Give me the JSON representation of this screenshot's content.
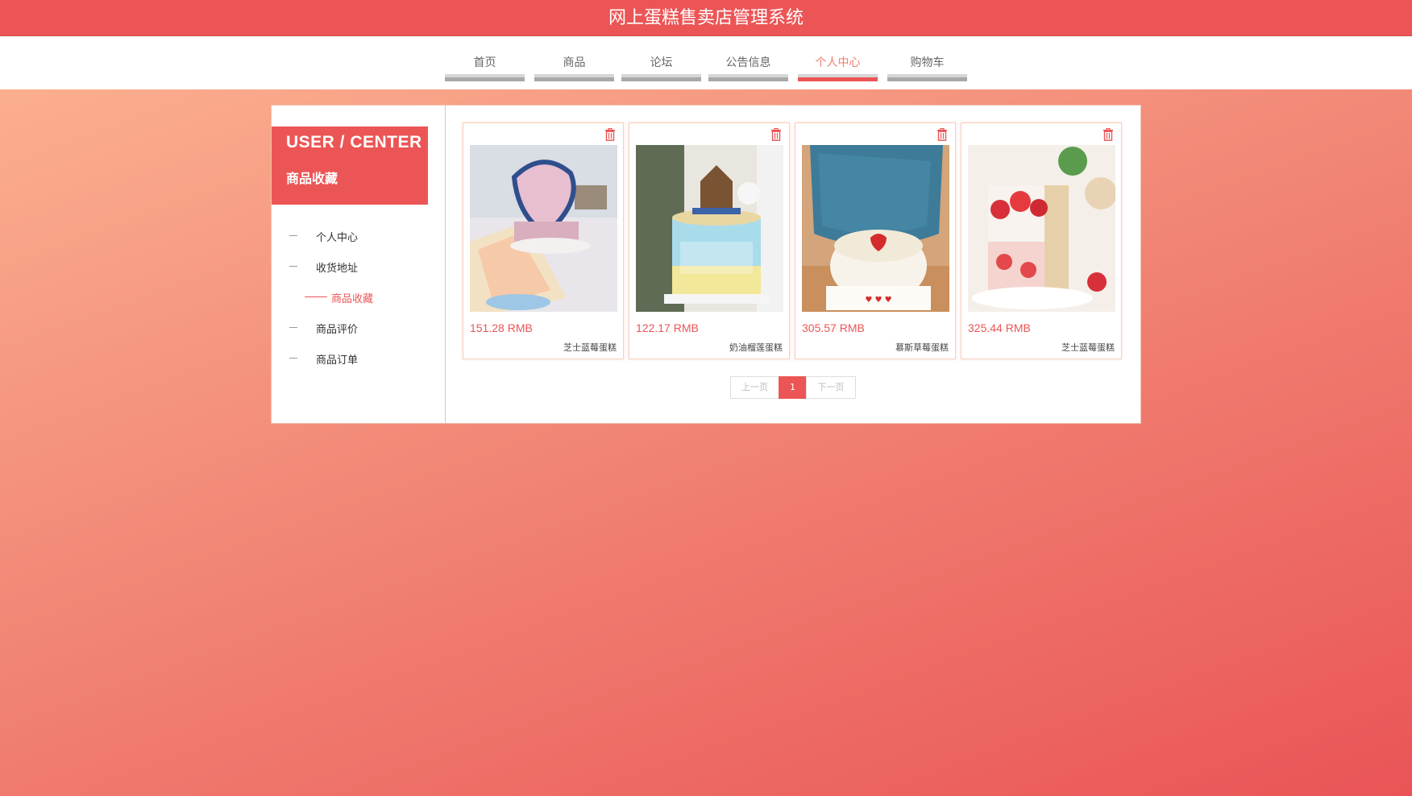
{
  "header": {
    "title": "网上蛋糕售卖店管理系统"
  },
  "nav": {
    "items": [
      {
        "label": "首页"
      },
      {
        "label": "商品"
      },
      {
        "label": "论坛"
      },
      {
        "label": "公告信息"
      },
      {
        "label": "个人中心"
      },
      {
        "label": "购物车"
      }
    ],
    "active": "个人中心"
  },
  "sidebar": {
    "title": "USER / CENTER",
    "subtitle": "商品收藏",
    "items": [
      {
        "label": "个人中心"
      },
      {
        "label": "收货地址"
      },
      {
        "label": "商品收藏"
      },
      {
        "label": "商品评价"
      },
      {
        "label": "商品订单"
      }
    ],
    "active": "商品收藏"
  },
  "favorites": [
    {
      "price": "151.28 RMB",
      "name": "芝士蓝莓蛋糕",
      "image": "heart-shaped-blue-pink-cake"
    },
    {
      "price": "122.17 RMB",
      "name": "奶油榴莲蛋糕",
      "image": "sailing-ship-cake"
    },
    {
      "price": "305.57 RMB",
      "name": "慕斯草莓蛋糕",
      "image": "heart-strawberry-cake"
    },
    {
      "price": "325.44 RMB",
      "name": "芝士蓝莓蛋糕",
      "image": "strawberry-layer-cake"
    }
  ],
  "pagination": {
    "prev": "上一页",
    "current": "1",
    "next": "下一页"
  },
  "icons": {
    "delete": "trash-icon"
  },
  "colors": {
    "accent": "#ec5556",
    "nav_active": "#f07c70"
  }
}
